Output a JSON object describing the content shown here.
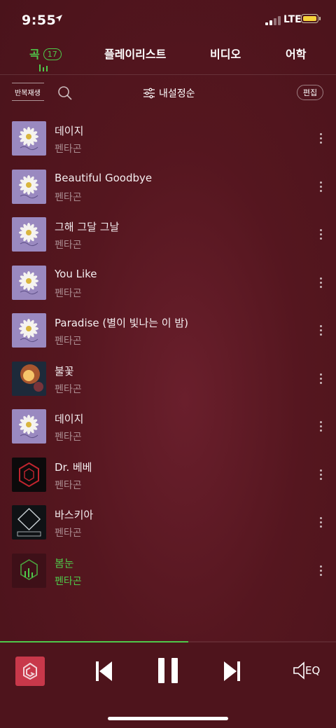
{
  "status": {
    "time": "9:55",
    "network": "LTE"
  },
  "tabs": [
    {
      "label": "곡",
      "count": "17"
    },
    {
      "label": "플레이리스트"
    },
    {
      "label": "비디오"
    },
    {
      "label": "어학"
    }
  ],
  "toolbar": {
    "repeat_label": "반복재생",
    "sort_label": "내설정순",
    "edit_label": "편집"
  },
  "songs": [
    {
      "title": "데이지",
      "artist": "펜타곤",
      "art": "daisy"
    },
    {
      "title": "Beautiful Goodbye",
      "artist": "펜타곤",
      "art": "daisy"
    },
    {
      "title": "그해 그달 그날",
      "artist": "펜타곤",
      "art": "daisy"
    },
    {
      "title": "You Like",
      "artist": "펜타곤",
      "art": "daisy"
    },
    {
      "title": "Paradise (별이 빛나는 이 밤)",
      "artist": "펜타곤",
      "art": "daisy"
    },
    {
      "title": "불꽃",
      "artist": "펜타곤",
      "art": "fireworks"
    },
    {
      "title": "데이지",
      "artist": "펜타곤",
      "art": "daisy"
    },
    {
      "title": "Dr. 베베",
      "artist": "펜타곤",
      "art": "hexagon"
    },
    {
      "title": "바스키아",
      "artist": "펜타곤",
      "art": "final"
    },
    {
      "title": "봄눈",
      "artist": "펜타곤",
      "art": "logo",
      "playing": true
    }
  ],
  "player": {
    "progress": 0.56,
    "eq_label": "EQ"
  },
  "colors": {
    "accent": "#4fc94a",
    "background": "#55161f"
  }
}
